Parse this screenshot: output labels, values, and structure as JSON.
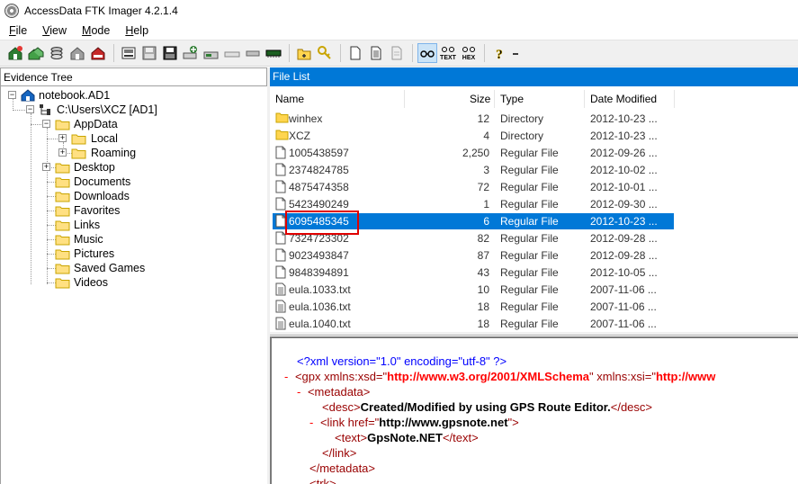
{
  "window": {
    "title": "AccessData FTK Imager 4.2.1.4"
  },
  "menu": [
    {
      "label": "File",
      "u": "F",
      "rest": "ile"
    },
    {
      "label": "View",
      "u": "V",
      "rest": "iew"
    },
    {
      "label": "Mode",
      "u": "M",
      "rest": "ode"
    },
    {
      "label": "Help",
      "u": "H",
      "rest": "elp"
    }
  ],
  "toolbar": {
    "text_view_label": "TEXT",
    "hex_view_label": "HEX",
    "help_label": "?"
  },
  "evidence_tree": {
    "header": "Evidence Tree",
    "items": [
      {
        "label": "notebook.AD1",
        "icon": "evidence-icon"
      },
      {
        "label": "C:\\Users\\XCZ [AD1]",
        "icon": "folder-tree-icon"
      },
      {
        "label": "AppData",
        "icon": "folder-icon"
      },
      {
        "label": "Local",
        "icon": "folder-icon"
      },
      {
        "label": "Roaming",
        "icon": "folder-icon"
      },
      {
        "label": "Desktop",
        "icon": "folder-icon"
      },
      {
        "label": "Documents",
        "icon": "folder-icon"
      },
      {
        "label": "Downloads",
        "icon": "folder-icon"
      },
      {
        "label": "Favorites",
        "icon": "folder-icon"
      },
      {
        "label": "Links",
        "icon": "folder-icon"
      },
      {
        "label": "Music",
        "icon": "folder-icon"
      },
      {
        "label": "Pictures",
        "icon": "folder-icon"
      },
      {
        "label": "Saved Games",
        "icon": "folder-icon"
      },
      {
        "label": "Videos",
        "icon": "folder-icon"
      }
    ]
  },
  "file_list": {
    "header": "File List",
    "columns": {
      "name": "Name",
      "size": "Size",
      "type": "Type",
      "date": "Date Modified"
    },
    "rows": [
      {
        "name": "winhex",
        "size": "12",
        "type": "Directory",
        "date": "2012-10-23 ...",
        "icon": "folder-icon"
      },
      {
        "name": "XCZ",
        "size": "4",
        "type": "Directory",
        "date": "2012-10-23 ...",
        "icon": "folder-icon"
      },
      {
        "name": "1005438597",
        "size": "2,250",
        "type": "Regular File",
        "date": "2012-09-26 ...",
        "icon": "file-icon"
      },
      {
        "name": "2374824785",
        "size": "3",
        "type": "Regular File",
        "date": "2012-10-02 ...",
        "icon": "file-icon"
      },
      {
        "name": "4875474358",
        "size": "72",
        "type": "Regular File",
        "date": "2012-10-01 ...",
        "icon": "file-icon"
      },
      {
        "name": "5423490249",
        "size": "1",
        "type": "Regular File",
        "date": "2012-09-30 ...",
        "icon": "file-icon"
      },
      {
        "name": "6095485345",
        "size": "6",
        "type": "Regular File",
        "date": "2012-10-23 ...",
        "icon": "file-icon",
        "selected": true
      },
      {
        "name": "7324723302",
        "size": "82",
        "type": "Regular File",
        "date": "2012-09-28 ...",
        "icon": "file-icon"
      },
      {
        "name": "9023493847",
        "size": "87",
        "type": "Regular File",
        "date": "2012-09-28 ...",
        "icon": "file-icon"
      },
      {
        "name": "9848394891",
        "size": "43",
        "type": "Regular File",
        "date": "2012-10-05 ...",
        "icon": "file-icon"
      },
      {
        "name": "eula.1033.txt",
        "size": "10",
        "type": "Regular File",
        "date": "2007-11-06 ...",
        "icon": "text-file-icon"
      },
      {
        "name": "eula.1036.txt",
        "size": "18",
        "type": "Regular File",
        "date": "2007-11-06 ...",
        "icon": "text-file-icon"
      },
      {
        "name": "eula.1040.txt",
        "size": "18",
        "type": "Regular File",
        "date": "2007-11-06 ...",
        "icon": "text-file-icon"
      }
    ]
  },
  "viewer": {
    "line1": "<?xml version=\"1.0\" encoding=\"utf-8\" ?>",
    "line2_tag": "<gpx xmlns:xsd=\"",
    "line2_val1": "http://www.w3.org/2001/XMLSchema",
    "line2_mid": "\" xmlns:xsi=\"",
    "line2_val2": "http://www",
    "line3": "<metadata>",
    "line4_open": "<desc>",
    "line4_text": "Created/Modified by using GPS Route Editor.",
    "line4_close": "</desc>",
    "line5_open": "<link href=\"",
    "line5_val": "http://www.gpsnote.net",
    "line5_close": "\">",
    "line6_open": "<text>",
    "line6_text": "GpsNote.NET",
    "line6_close": "</text>",
    "line7": "</link>",
    "line8": "</metadata>",
    "line9": "<trk>",
    "dash": "-"
  }
}
